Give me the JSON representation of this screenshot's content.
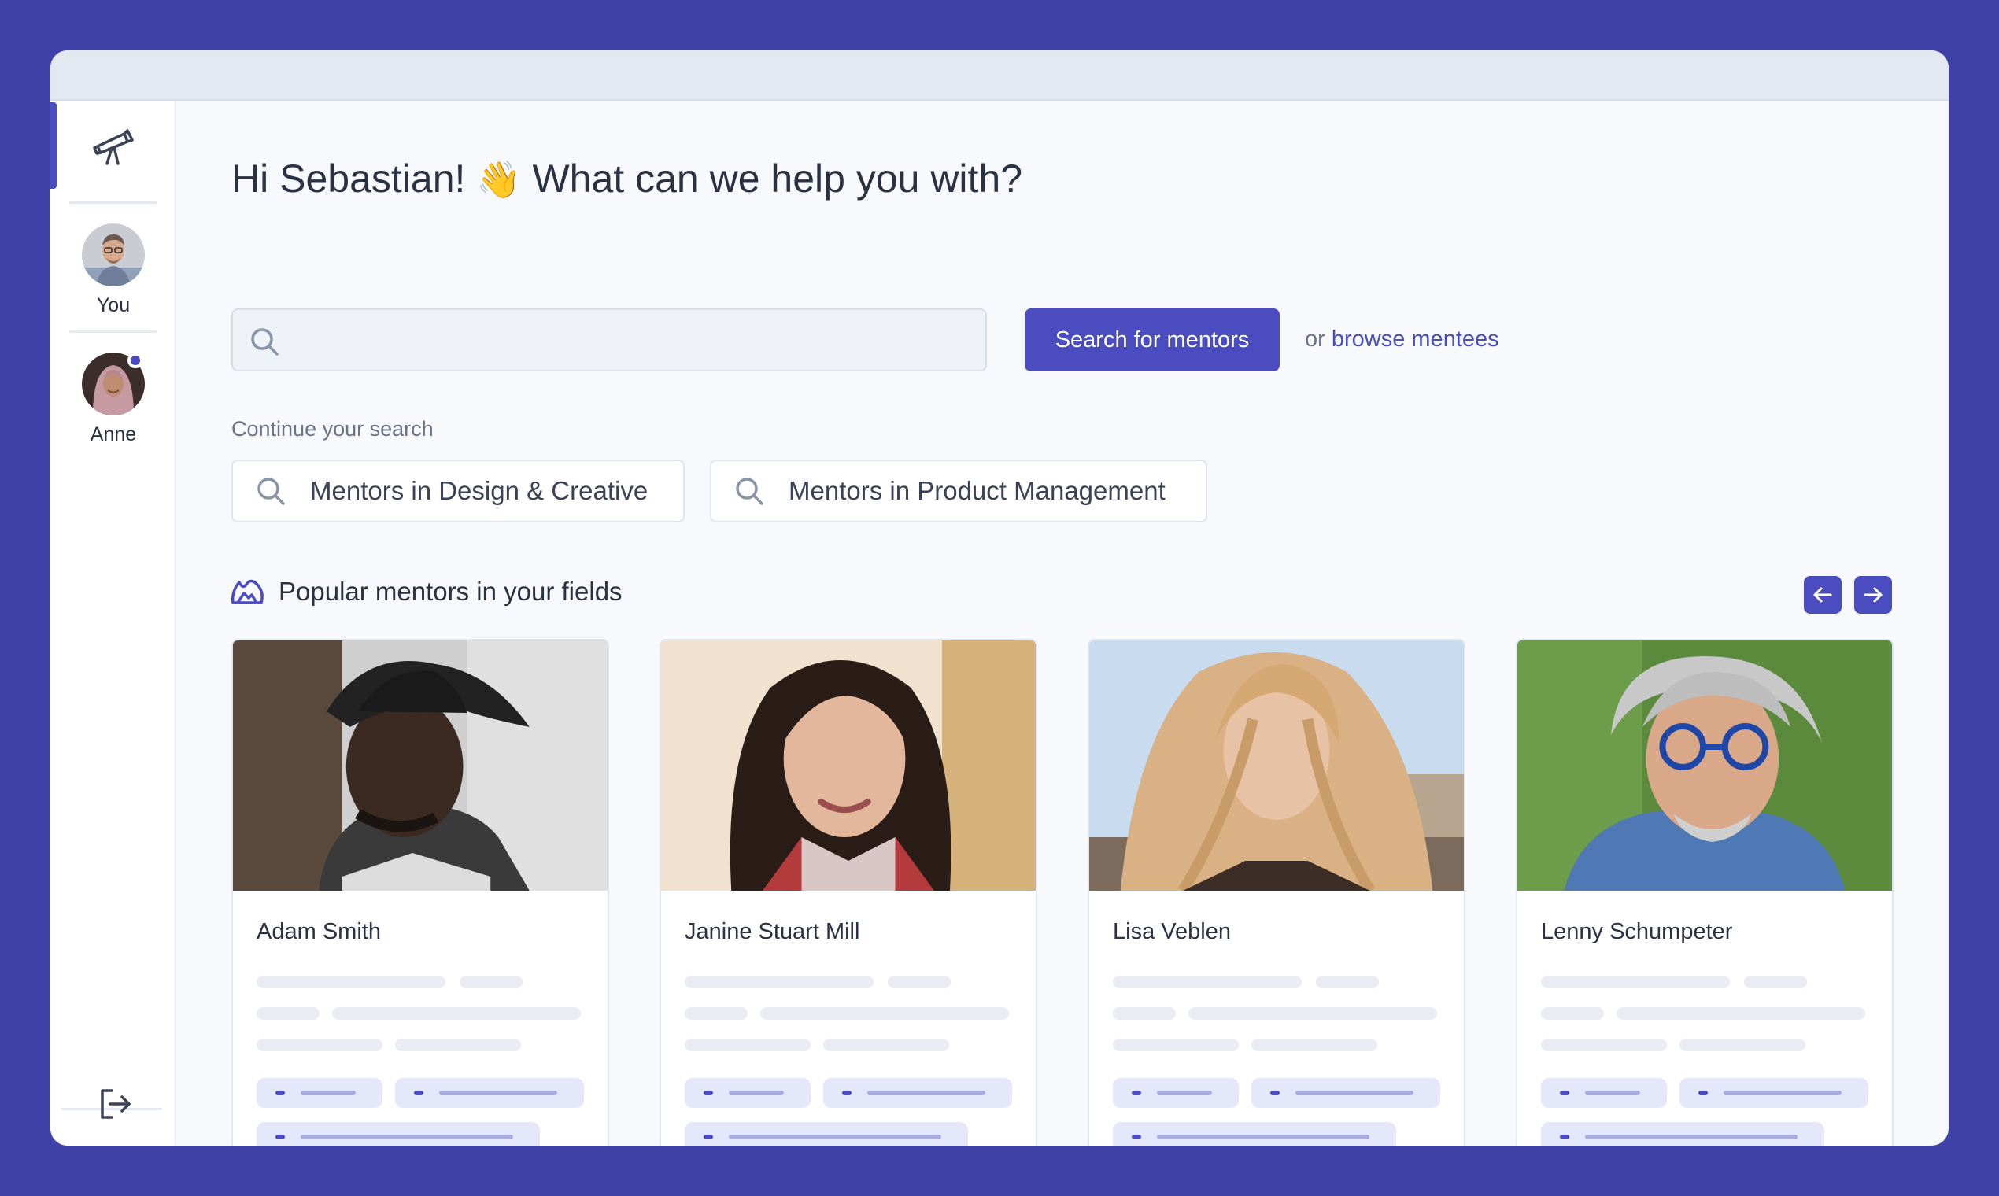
{
  "app": {
    "user": "You",
    "contacts": [
      {
        "name": "Anne",
        "online": true
      }
    ]
  },
  "main": {
    "greeting": "Hi Sebastian!",
    "greeting_emoji": "👋",
    "greeting_question": "What can we help you with?",
    "search": {
      "placeholder": "",
      "value": ""
    },
    "search_button": "Search for mentors",
    "browse_prefix": "or",
    "browse_link": "browse mentees",
    "continue_label": "Continue your search",
    "recent_searches": [
      "Mentors in Design & Creative",
      "Mentors in Product Management"
    ],
    "popular_title": "Popular mentors in your fields",
    "mentors": [
      "Adam Smith",
      "Janine Stuart Mill",
      "Lisa Veblen",
      "Lenny Schumpeter"
    ]
  },
  "colors": {
    "accent": "#4a4cbf",
    "background": "#4041a6",
    "panel": "#f8f9fc",
    "skeleton": "#e9ecf3",
    "pill": "#e4e8fa"
  },
  "icons": [
    "telescope-icon",
    "logout-icon",
    "search-icon",
    "mountain-icon",
    "arrow-left-icon",
    "arrow-right-icon"
  ]
}
